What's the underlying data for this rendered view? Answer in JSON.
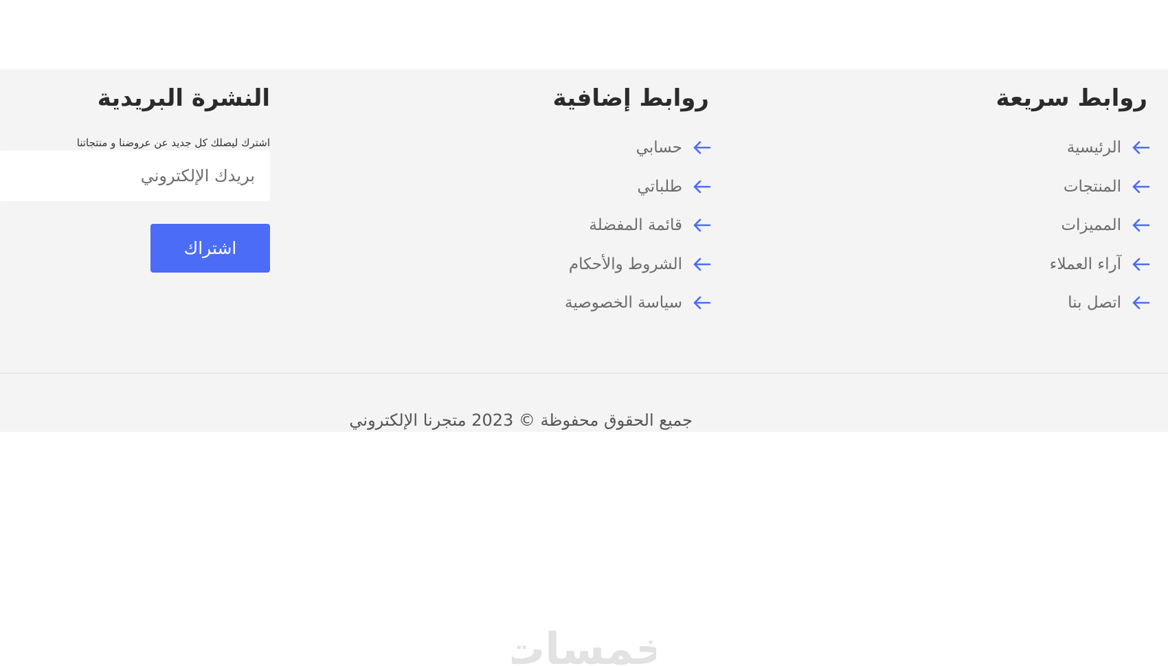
{
  "footer": {
    "quick_links": {
      "title": "روابط سريعة",
      "items": [
        {
          "label": "الرئيسية",
          "icon": "arrow-left-icon"
        },
        {
          "label": "المنتجات",
          "icon": "arrow-left-icon"
        },
        {
          "label": "المميزات",
          "icon": "arrow-left-icon"
        },
        {
          "label": "آراء العملاء",
          "icon": "arrow-left-icon"
        },
        {
          "label": "اتصل بنا",
          "icon": "arrow-left-icon"
        }
      ]
    },
    "extra_links": {
      "title": "روابط إضافية",
      "items": [
        {
          "label": "حسابي",
          "icon": "arrow-left-icon"
        },
        {
          "label": "طلباتي",
          "icon": "arrow-left-icon"
        },
        {
          "label": "قائمة المفضلة",
          "icon": "arrow-left-icon"
        },
        {
          "label": "الشروط والأحكام",
          "icon": "arrow-left-icon"
        },
        {
          "label": "سياسة الخصوصية",
          "icon": "arrow-left-icon"
        }
      ]
    },
    "newsletter": {
      "title": "النشرة البريدية",
      "text": "اشترك ليصلك كل جديد عن عروضنا و منتجاتنا",
      "email_placeholder": "بريدك الإلكتروني",
      "email_value": "",
      "button_label": "اشتراك"
    },
    "copyright": "جميع الحقوق محفوظة © 2023 متجرنا الإلكتروني"
  },
  "watermark": {
    "text": "خمسات"
  },
  "colors": {
    "footer_bg": "#f4f4f4",
    "accent": "#4a6cf7",
    "arrow": "#4a6cf7",
    "link_text": "#6b6b6b",
    "heading": "#2b2b2b"
  }
}
